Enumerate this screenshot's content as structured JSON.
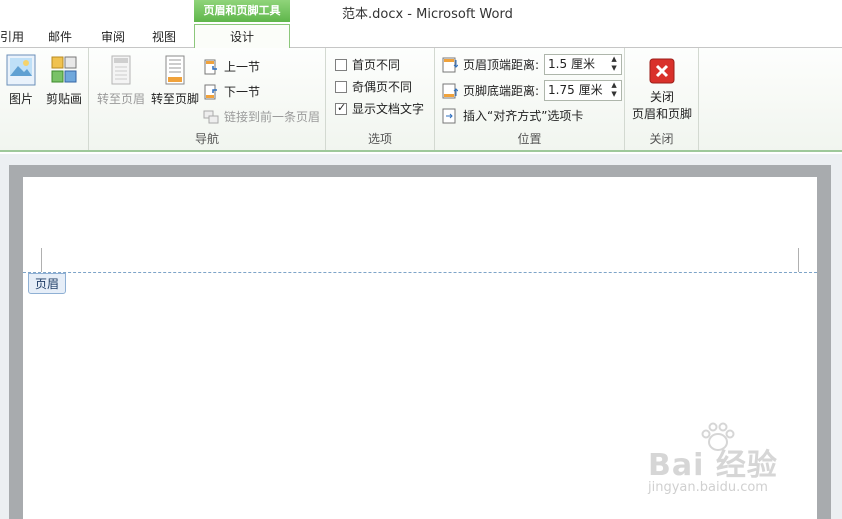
{
  "window": {
    "title": "范本.docx  -  Microsoft Word",
    "contextual_tab_group": "页眉和页脚工具"
  },
  "tabs": [
    {
      "label": "引用"
    },
    {
      "label": "邮件"
    },
    {
      "label": "审阅"
    },
    {
      "label": "视图"
    },
    {
      "label": "设计",
      "active": true
    }
  ],
  "ribbon": {
    "insert_group": {
      "picture_label": "图片",
      "clipart_label": "剪贴画"
    },
    "nav_group": {
      "label": "导航",
      "goto_header": "转至页眉",
      "goto_footer": "转至页脚",
      "prev_section": "上一节",
      "next_section": "下一节",
      "link_previous": "链接到前一条页眉"
    },
    "options_group": {
      "label": "选项",
      "different_first_page": {
        "label": "首页不同",
        "checked": false
      },
      "different_odd_even": {
        "label": "奇偶页不同",
        "checked": false
      },
      "show_document_text": {
        "label": "显示文档文字",
        "checked": true
      }
    },
    "position_group": {
      "label": "位置",
      "header_from_top_label": "页眉顶端距离:",
      "header_from_top_value": "1.5 厘米",
      "footer_from_bottom_label": "页脚底端距离:",
      "footer_from_bottom_value": "1.75 厘米",
      "insert_alignment_tab": "插入“对齐方式”选项卡"
    },
    "close_group": {
      "label": "关闭",
      "close_button_line1": "关闭",
      "close_button_line2": "页眉和页脚"
    }
  },
  "document": {
    "header_tag": "页眉"
  },
  "watermark": {
    "main": "Bai 经验",
    "sub": "jingyan.baidu.com"
  },
  "colors": {
    "contextual_green": "#5fb64b",
    "close_red": "#d9312b",
    "header_dashed": "#7ea4c8"
  }
}
